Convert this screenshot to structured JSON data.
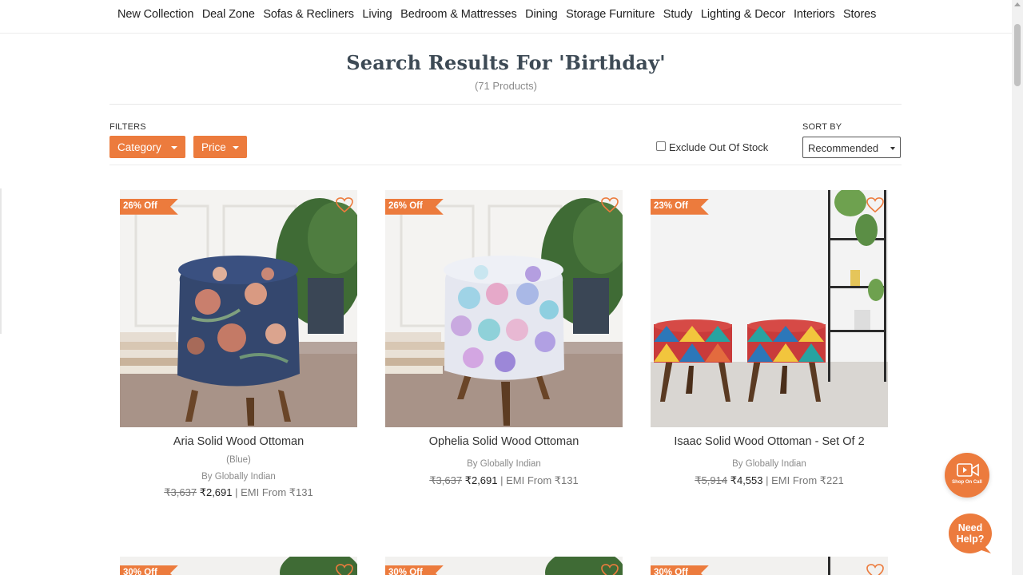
{
  "nav": {
    "items": [
      "New Collection",
      "Deal Zone",
      "Sofas & Recliners",
      "Living",
      "Bedroom & Mattresses",
      "Dining",
      "Storage Furniture",
      "Study",
      "Lighting & Decor",
      "Interiors",
      "Stores"
    ]
  },
  "search": {
    "title": "Search Results For 'Birthday'",
    "count": "(71 Products)"
  },
  "filters": {
    "label": "FILTERS",
    "category": "Category",
    "price": "Price",
    "exclude_out_of_stock": "Exclude Out Of Stock",
    "sort_label": "SORT BY",
    "sort_value": "Recommended"
  },
  "colors": {
    "accent": "#ec7b3d",
    "text": "#333333",
    "muted": "#888888"
  },
  "products": [
    {
      "discount": "26% Off",
      "name": "Aria Solid Wood Ottoman",
      "variant": "(Blue)",
      "brand": "By Globally Indian",
      "mrp": "₹3,637",
      "price": "₹2,691",
      "emi": " | EMI From ₹131"
    },
    {
      "discount": "26% Off",
      "name": "Ophelia Solid Wood Ottoman",
      "brand": "By Globally Indian",
      "mrp": "₹3,637",
      "price": "₹2,691",
      "emi": " | EMI From ₹131"
    },
    {
      "discount": "23% Off",
      "name": "Isaac Solid Wood Ottoman - Set Of 2",
      "brand": "By Globally Indian",
      "mrp": "₹5,914",
      "price": "₹4,553",
      "emi": " | EMI From ₹221"
    }
  ],
  "next_row_badges": [
    "30% Off",
    "30% Off",
    "30% Off"
  ],
  "widgets": {
    "shop_on_call": "Shop On Call",
    "need_help": "Need Help?"
  }
}
